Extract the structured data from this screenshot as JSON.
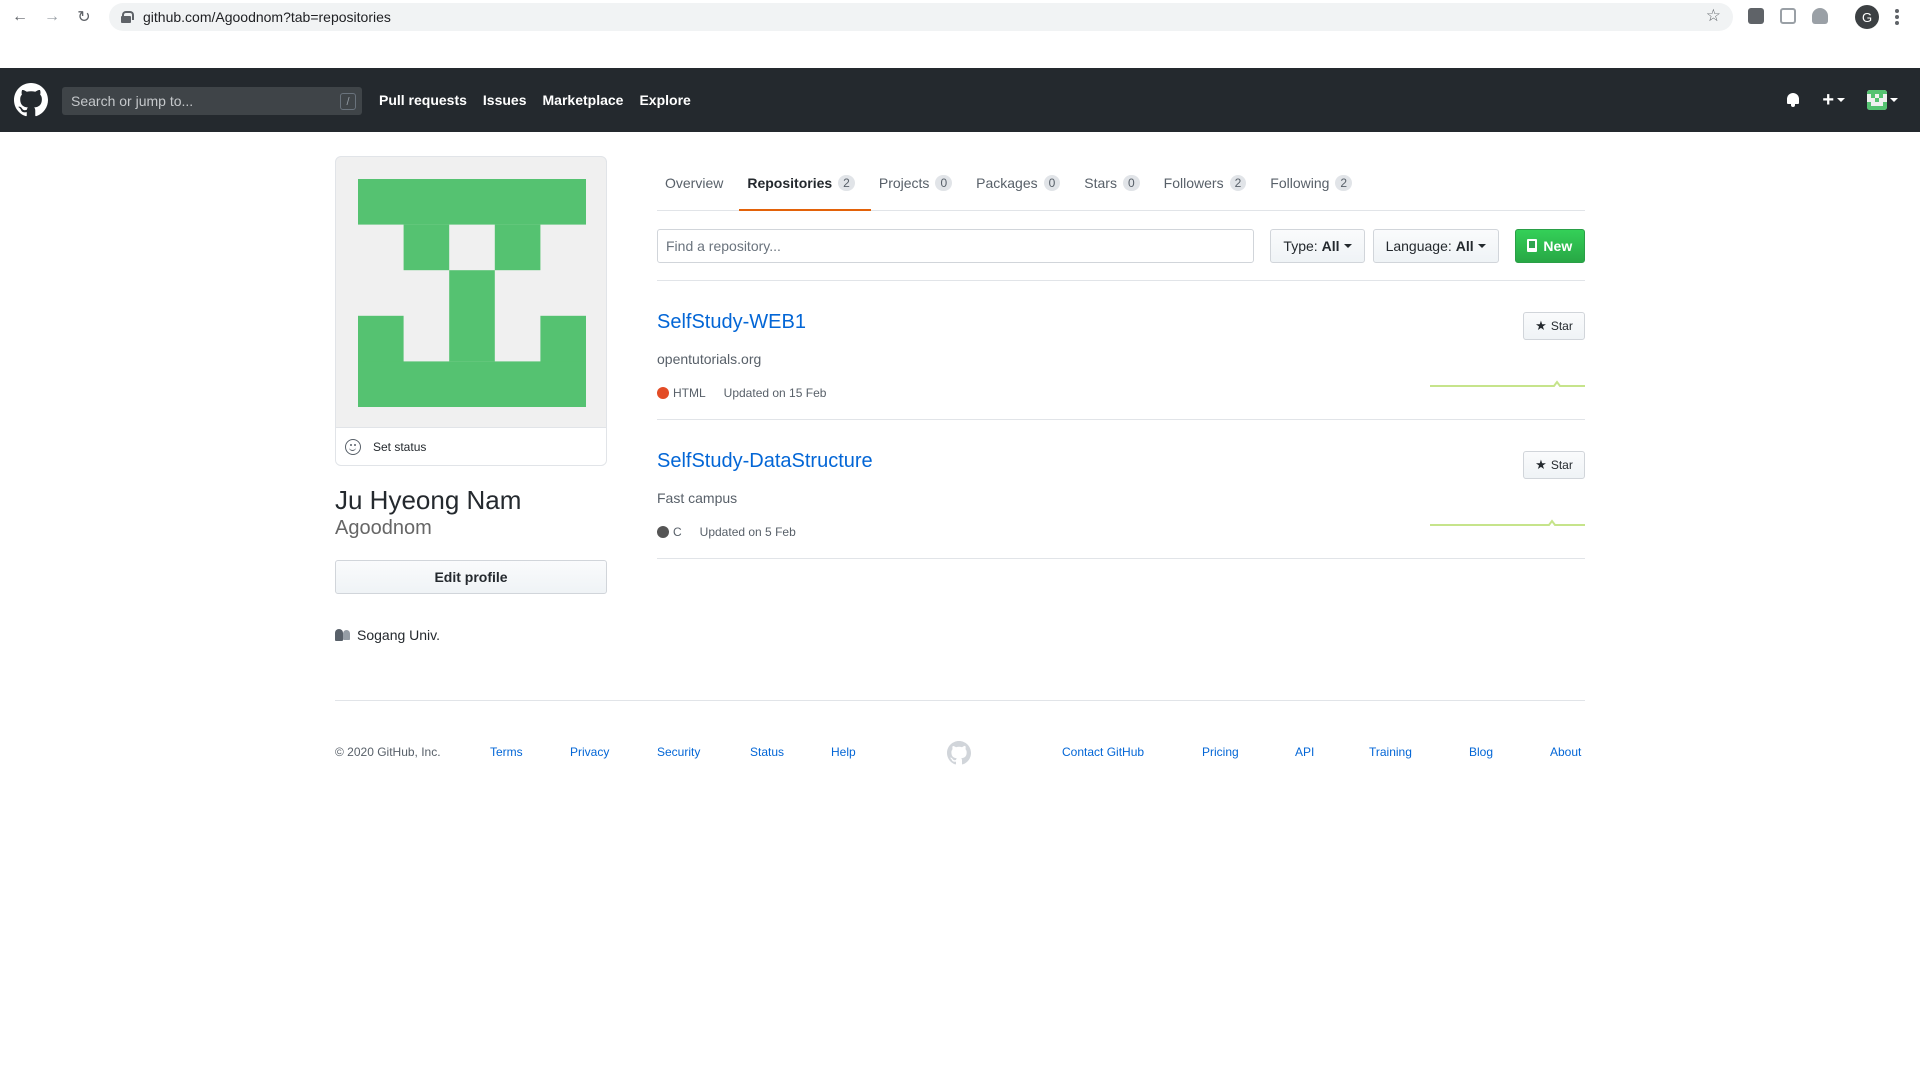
{
  "browser": {
    "url": "github.com/Agoodnom?tab=repositories",
    "profile_initial": "G"
  },
  "header": {
    "search_placeholder": "Search or jump to...",
    "search_key": "/",
    "nav": [
      "Pull requests",
      "Issues",
      "Marketplace",
      "Explore"
    ]
  },
  "profile": {
    "set_status": "Set status",
    "full_name": "Ju Hyeong Nam",
    "username": "Agoodnom",
    "edit_profile": "Edit profile",
    "organization": "Sogang Univ.",
    "avatar_color": "#55c271",
    "avatar_bg": "#f0f0f0"
  },
  "tabs": [
    {
      "label": "Overview",
      "count": null
    },
    {
      "label": "Repositories",
      "count": "2"
    },
    {
      "label": "Projects",
      "count": "0"
    },
    {
      "label": "Packages",
      "count": "0"
    },
    {
      "label": "Stars",
      "count": "0"
    },
    {
      "label": "Followers",
      "count": "2"
    },
    {
      "label": "Following",
      "count": "2"
    }
  ],
  "active_tab": "Repositories",
  "filters": {
    "find_placeholder": "Find a repository...",
    "type_label": "Type:",
    "type_value": "All",
    "language_label": "Language:",
    "language_value": "All",
    "new_label": "New"
  },
  "repos": [
    {
      "name": "SelfStudy-WEB1",
      "description": "opentutorials.org",
      "language": "HTML",
      "language_color": "#e34c26",
      "updated": "Updated on 15 Feb",
      "star_label": "Star"
    },
    {
      "name": "SelfStudy-DataStructure",
      "description": "Fast campus",
      "language": "C",
      "language_color": "#555555",
      "updated": "Updated on 5 Feb",
      "star_label": "Star"
    }
  ],
  "footer": {
    "copyright": "© 2020 GitHub, Inc.",
    "left_links": [
      "Terms",
      "Privacy",
      "Security",
      "Status",
      "Help"
    ],
    "right_links": [
      "Contact GitHub",
      "Pricing",
      "API",
      "Training",
      "Blog",
      "About"
    ]
  },
  "colors": {
    "header_bg": "#24292e",
    "accent_tab": "#e36209",
    "link": "#0366d6",
    "new_button": "#28a745"
  }
}
